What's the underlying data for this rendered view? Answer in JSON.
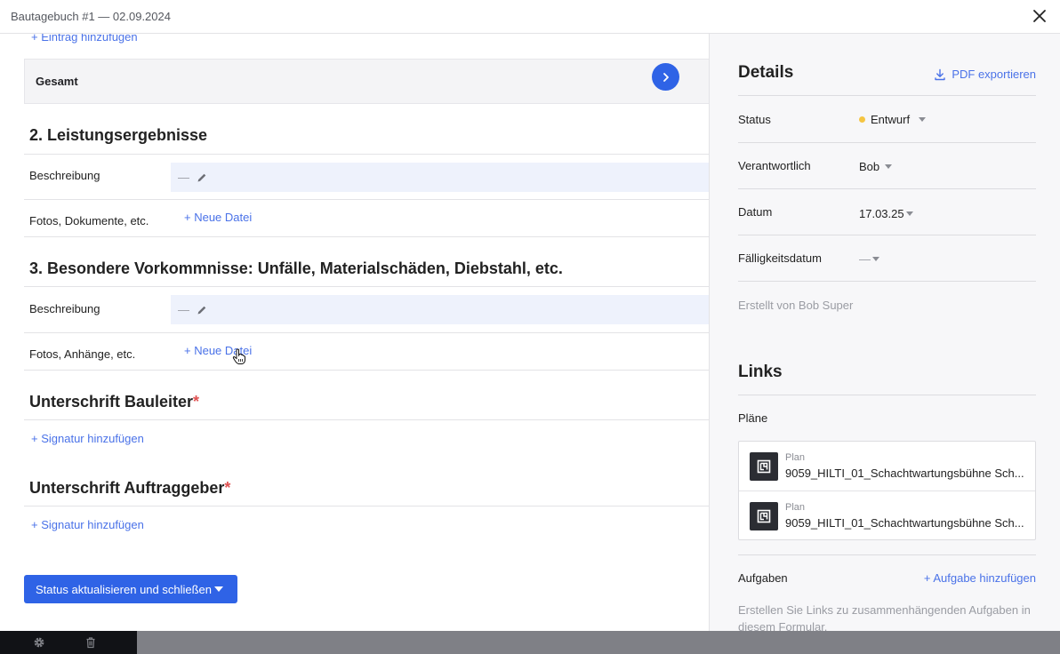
{
  "window": {
    "title": "Bautagebuch #1 — 02.09.2024"
  },
  "colors": {
    "accent": "#2f63e6",
    "link": "#4a72e8",
    "status_dot": "#f5c542",
    "required": "#e05252"
  },
  "main": {
    "add_entry_link": "+ Eintrag hinzufügen",
    "total_label": "Gesamt",
    "section2": {
      "title": "2. Leistungsergebnisse",
      "description_label": "Beschreibung",
      "description_value": "—",
      "files_label": "Fotos, Dokumente, etc.",
      "new_file_link": "+ Neue Datei"
    },
    "section3": {
      "title": "3. Besondere Vorkommnisse: Unfälle, Materialschäden, Diebstahl, etc.",
      "description_label": "Beschreibung",
      "description_value": "—",
      "files_label": "Fotos, Anhänge, etc.",
      "new_file_link": "+ Neue Datei"
    },
    "signature_site_manager": {
      "title": "Unterschrift Bauleiter",
      "required_mark": "*",
      "add_link": "+ Signatur hinzufügen"
    },
    "signature_client": {
      "title": "Unterschrift Auftraggeber",
      "required_mark": "*",
      "add_link": "+ Signatur hinzufügen"
    },
    "submit_button": "Status aktualisieren und schließen"
  },
  "details": {
    "title": "Details",
    "export_label": "PDF exportieren",
    "status_label": "Status",
    "status_value": "Entwurf",
    "responsible_label": "Verantwortlich",
    "responsible_value": "Bob",
    "date_label": "Datum",
    "date_value": "17.03.25",
    "due_label": "Fälligkeitsdatum",
    "due_value": "—",
    "created_by": "Erstellt von Bob Super"
  },
  "links": {
    "title": "Links",
    "plans_label": "Pläne",
    "plans": [
      {
        "kind": "Plan",
        "name": "9059_HILTI_01_Schachtwartungsbühne Sch..."
      },
      {
        "kind": "Plan",
        "name": "9059_HILTI_01_Schachtwartungsbühne Sch..."
      }
    ],
    "tasks_label": "Aufgaben",
    "add_task_link": "+ Aufgabe hinzufügen",
    "tasks_hint": "Erstellen Sie Links zu zusammenhängenden Aufgaben in diesem Formular."
  }
}
